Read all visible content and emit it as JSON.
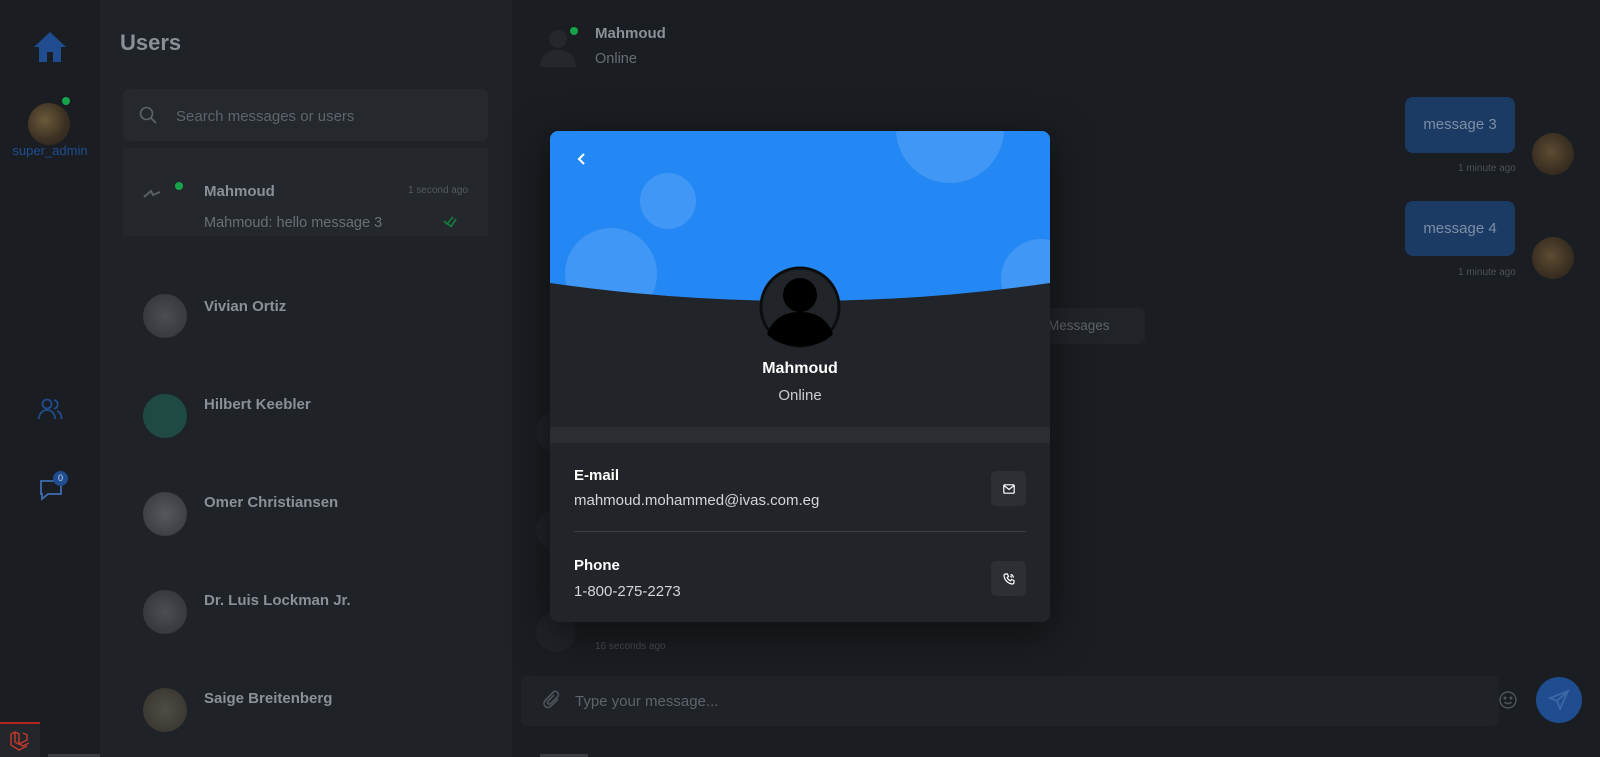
{
  "rail": {
    "username": "super_admin",
    "chat_badge": "0"
  },
  "users_panel": {
    "title": "Users",
    "search_placeholder": "Search messages or users",
    "conversations": [
      {
        "name": "Mahmoud",
        "time": "1 second ago",
        "preview": "Mahmoud: hello message 3"
      },
      {
        "name": "Vivian Ortiz"
      },
      {
        "name": "Hilbert Keebler"
      },
      {
        "name": "Omer Christiansen"
      },
      {
        "name": "Dr. Luis Lockman Jr."
      },
      {
        "name": "Saige Breitenberg"
      }
    ]
  },
  "chat": {
    "header": {
      "name": "Mahmoud",
      "status": "Online"
    },
    "messages": [
      {
        "text": "message 3",
        "time": "1 minute ago"
      },
      {
        "text": "message 4",
        "time": "1 minute ago"
      }
    ],
    "date_pill": "Messages",
    "small_time": "16 seconds ago",
    "composer_placeholder": "Type your message..."
  },
  "modal": {
    "name": "Mahmoud",
    "status": "Online",
    "email_label": "E-mail",
    "email_value": "mahmoud.mohammed@ivas.com.eg",
    "phone_label": "Phone",
    "phone_value": "1-800-275-2273"
  },
  "colors": {
    "accent": "#2488f4",
    "online": "#16a34a",
    "background": "#1a1d21",
    "modal_bg": "#212428"
  },
  "icons": [
    "home-icon",
    "users-icon",
    "chat-icon",
    "search-icon",
    "double-check-icon",
    "attach-icon",
    "emoji-icon",
    "send-icon",
    "back-icon",
    "mail-icon",
    "phone-icon",
    "laravel-icon"
  ]
}
